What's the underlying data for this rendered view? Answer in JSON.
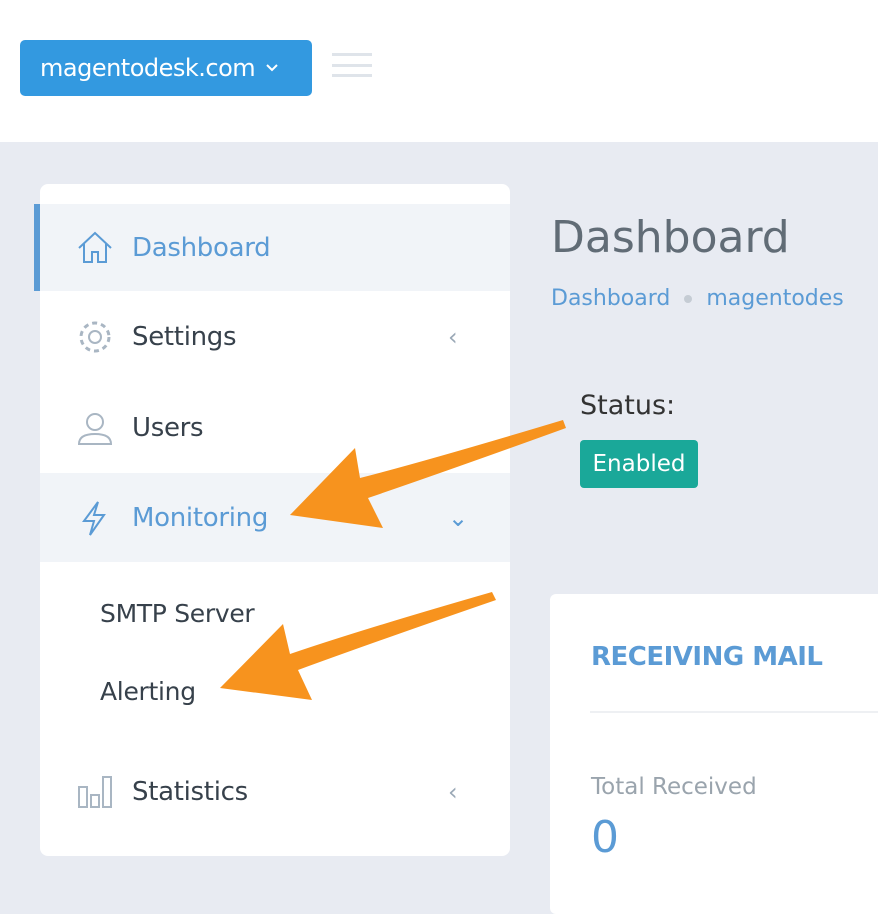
{
  "header": {
    "site_selector": "magentodesk.com",
    "site_chevron": "⌄"
  },
  "sidebar": {
    "items": [
      {
        "label": "Dashboard",
        "icon": "home-icon"
      },
      {
        "label": "Settings",
        "icon": "gear-icon",
        "chevron": "‹"
      },
      {
        "label": "Users",
        "icon": "user-icon"
      },
      {
        "label": "Monitoring",
        "icon": "bolt-icon",
        "chevron": "⌄"
      },
      {
        "label": "Statistics",
        "icon": "bar-chart-icon",
        "chevron": "‹"
      }
    ],
    "monitoring_sub": [
      "SMTP Server",
      "Alerting"
    ]
  },
  "main": {
    "title": "Dashboard",
    "breadcrumb": [
      "Dashboard",
      "magentodes"
    ],
    "status_label": "Status:",
    "status_value": "Enabled",
    "card": {
      "title": "RECEIVING MAIL",
      "stat_label": "Total Received",
      "stat_value": "0"
    }
  },
  "colors": {
    "accent": "#3399e0",
    "link": "#5b9bd5",
    "enabled": "#1aa899",
    "annotation": "#f7931e"
  }
}
